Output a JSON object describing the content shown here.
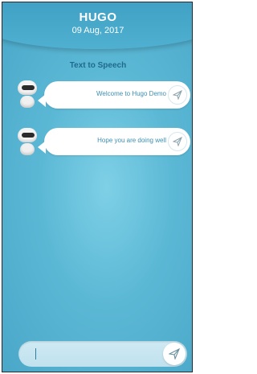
{
  "header": {
    "title": "HUGO",
    "date": "09 Aug, 2017"
  },
  "section": {
    "title": "Text to Speech"
  },
  "messages": [
    {
      "text": "Welcome to Hugo Demo"
    },
    {
      "text": "Hope you are doing well"
    }
  ],
  "input": {
    "value": ""
  },
  "icons": {
    "avatar": "robot-icon",
    "send": "send-icon"
  },
  "colors": {
    "accent": "#3a8fb5",
    "background": "#5bb8d5"
  }
}
